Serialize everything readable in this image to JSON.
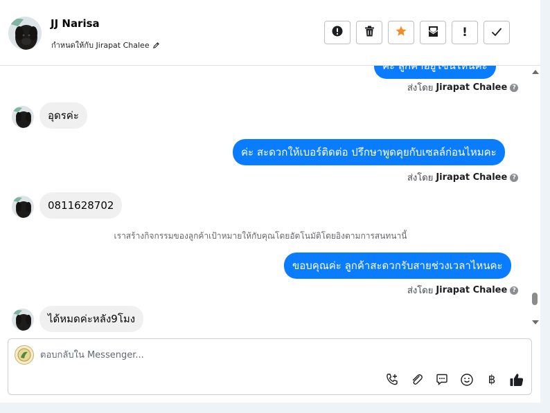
{
  "contact": {
    "name": "JJ Narisa",
    "assign_label": "กำหนดให้กับ Jirapat Chalee"
  },
  "header_actions": [
    {
      "id": "report",
      "icon": "alert-circle-icon"
    },
    {
      "id": "delete",
      "icon": "trash-icon"
    },
    {
      "id": "star",
      "icon": "star-icon",
      "color": "#f28c28"
    },
    {
      "id": "mark-unread",
      "icon": "envelope-open-icon"
    },
    {
      "id": "follow-up",
      "icon": "exclamation-icon",
      "glyph": "!"
    },
    {
      "id": "done",
      "icon": "check-icon"
    }
  ],
  "messages": {
    "m0": {
      "direction": "out",
      "text": "ค่ะ ลูกค้าอยู่โซนไหนคะ"
    },
    "m0_sentby": {
      "prefix": "ส่งโดย",
      "agent": "Jirapat Chalee"
    },
    "m1": {
      "direction": "in",
      "text": "อุดรค่ะ"
    },
    "m2": {
      "direction": "out",
      "text": "ค่ะ สะดวกให้เบอร์ติดต่อ ปรึกษาพูดคุยกับเซลล์ก่อนไหมคะ"
    },
    "m2_sentby": {
      "prefix": "ส่งโดย",
      "agent": "Jirapat Chalee"
    },
    "m3": {
      "direction": "in",
      "text": "0811628702"
    },
    "system": "เราสร้างกิจกรรมของลูกค้าเป้าหมายให้กับคุณโดยอัตโนมัติโดยอิงตามการสนทนานี้",
    "m4": {
      "direction": "out",
      "text": "ขอบคุณค่ะ ลูกค้าสะดวกรับสายช่วงเวลาไหนคะ"
    },
    "m4_sentby": {
      "prefix": "ส่งโดย",
      "agent": "Jirapat Chalee"
    },
    "m5": {
      "direction": "in",
      "text": "ได้หมดค่ะหลัง9โมง"
    }
  },
  "composer": {
    "placeholder": "ตอบกลับใน Messenger...",
    "tools": [
      "phone-plus-icon",
      "paperclip-icon",
      "chat-bubble-icon",
      "emoji-icon",
      "baht-icon",
      "thumbs-up-icon"
    ],
    "baht_glyph": "฿"
  },
  "colors": {
    "outgoing_bubble": "#0a7cff",
    "incoming_bubble": "#f0f0f0",
    "star": "#f28c28"
  }
}
